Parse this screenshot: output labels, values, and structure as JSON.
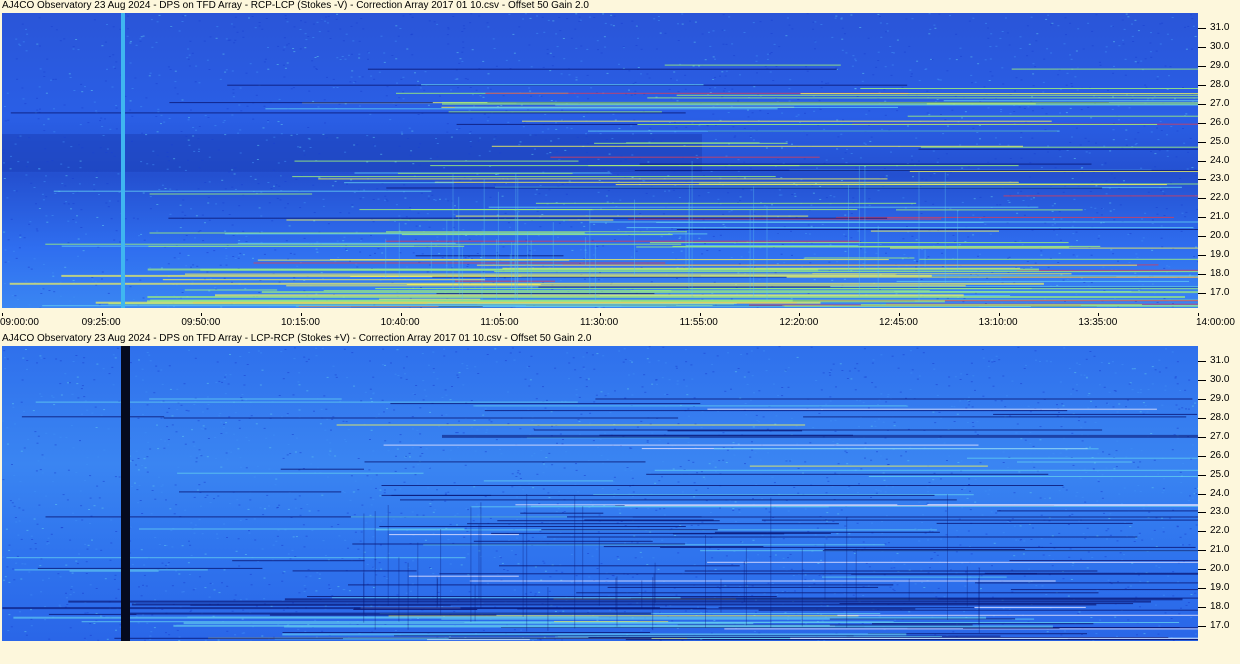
{
  "panels": [
    {
      "title": "AJ4CO Observatory 23 Aug 2024  -  DPS on TFD Array  -  RCP-LCP (Stokes -V)  -  Correction Array 2017 01 10.csv  -  Offset 50  Gain 2.0",
      "style": "rcp",
      "marker_color": "#3fb6f0"
    },
    {
      "title": "AJ4CO Observatory 23 Aug 2024  -  DPS on TFD Array  -  LCP-RCP (Stokes +V)  -  Correction Array 2017 01 10.csv  -  Offset 50  Gain 2.0",
      "style": "lcp",
      "marker_color": "#050a1e"
    }
  ],
  "chart_data": {
    "type": "heatmap",
    "x_ticks": [
      "09:00:00",
      "09:25:00",
      "09:50:00",
      "10:15:00",
      "10:40:00",
      "11:05:00",
      "11:30:00",
      "11:55:00",
      "12:20:00",
      "12:45:00",
      "13:10:00",
      "13:35:00",
      "14:00:00"
    ],
    "y_ticks": [
      "31.0",
      "30.0",
      "29.0",
      "28.0",
      "27.0",
      "26.0",
      "25.0",
      "24.0",
      "23.0",
      "22.0",
      "21.0",
      "20.0",
      "19.0",
      "18.0",
      "17.0"
    ],
    "y_range": [
      16.2,
      31.8
    ],
    "x_range": [
      "09:00:00",
      "14:00:00"
    ],
    "colors": [
      "#0a1a7a",
      "#1a3fd0",
      "#2b68ee",
      "#3f8ff5",
      "#5fc8f0",
      "#9ef07a",
      "#f2f25a",
      "#d04060"
    ]
  }
}
